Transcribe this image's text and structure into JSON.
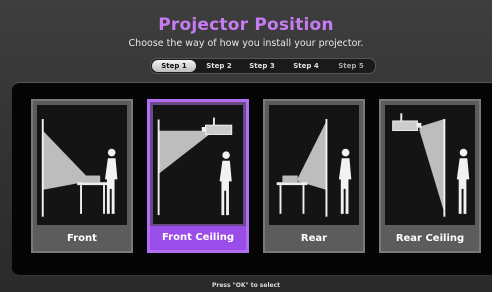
{
  "header": {
    "title": "Projector Position",
    "subtitle": "Choose the way of how you install your projector."
  },
  "steps": [
    "Step 1",
    "Step 2",
    "Step 3",
    "Step 4",
    "Step 5"
  ],
  "active_step": "Step 1",
  "options": [
    {
      "label": "Front",
      "icon": "front-projection-icon",
      "selected": false
    },
    {
      "label": "Front Ceiling",
      "icon": "front-ceiling-projection-icon",
      "selected": true
    },
    {
      "label": "Rear",
      "icon": "rear-projection-icon",
      "selected": false
    },
    {
      "label": "Rear Ceiling",
      "icon": "rear-ceiling-projection-icon",
      "selected": false
    }
  ],
  "footer": {
    "hint": "Press \"OK\" to select"
  },
  "colors": {
    "accent": "#b26ef2",
    "title": "#c77cf2",
    "selected_label_bg": "#9b4dea"
  }
}
